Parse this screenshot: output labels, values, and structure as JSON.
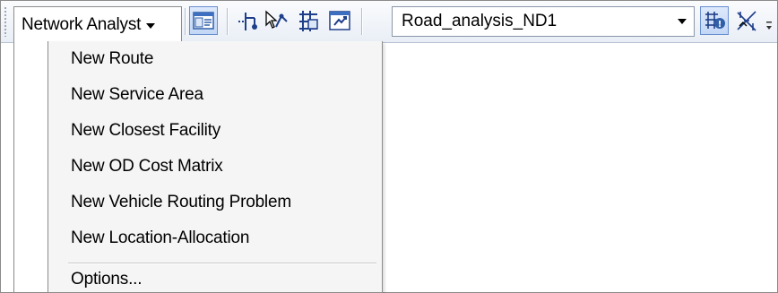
{
  "toolbar": {
    "network_analyst_label": "Network Analyst",
    "network_dataset": "Road_analysis_ND1",
    "icons": [
      "network-analyst-window-icon",
      "create-network-location-icon",
      "select-move-location-icon",
      "network-identify-icon",
      "solve-icon",
      "build-network-icon",
      "direction-window-icon"
    ]
  },
  "menu": {
    "items": [
      {
        "label": "New Route"
      },
      {
        "label": "New Service Area"
      },
      {
        "label": "New Closest Facility"
      },
      {
        "label": "New OD Cost Matrix"
      },
      {
        "label": "New Vehicle Routing Problem"
      },
      {
        "label": "New Location-Allocation"
      }
    ],
    "options_label": "Options..."
  }
}
